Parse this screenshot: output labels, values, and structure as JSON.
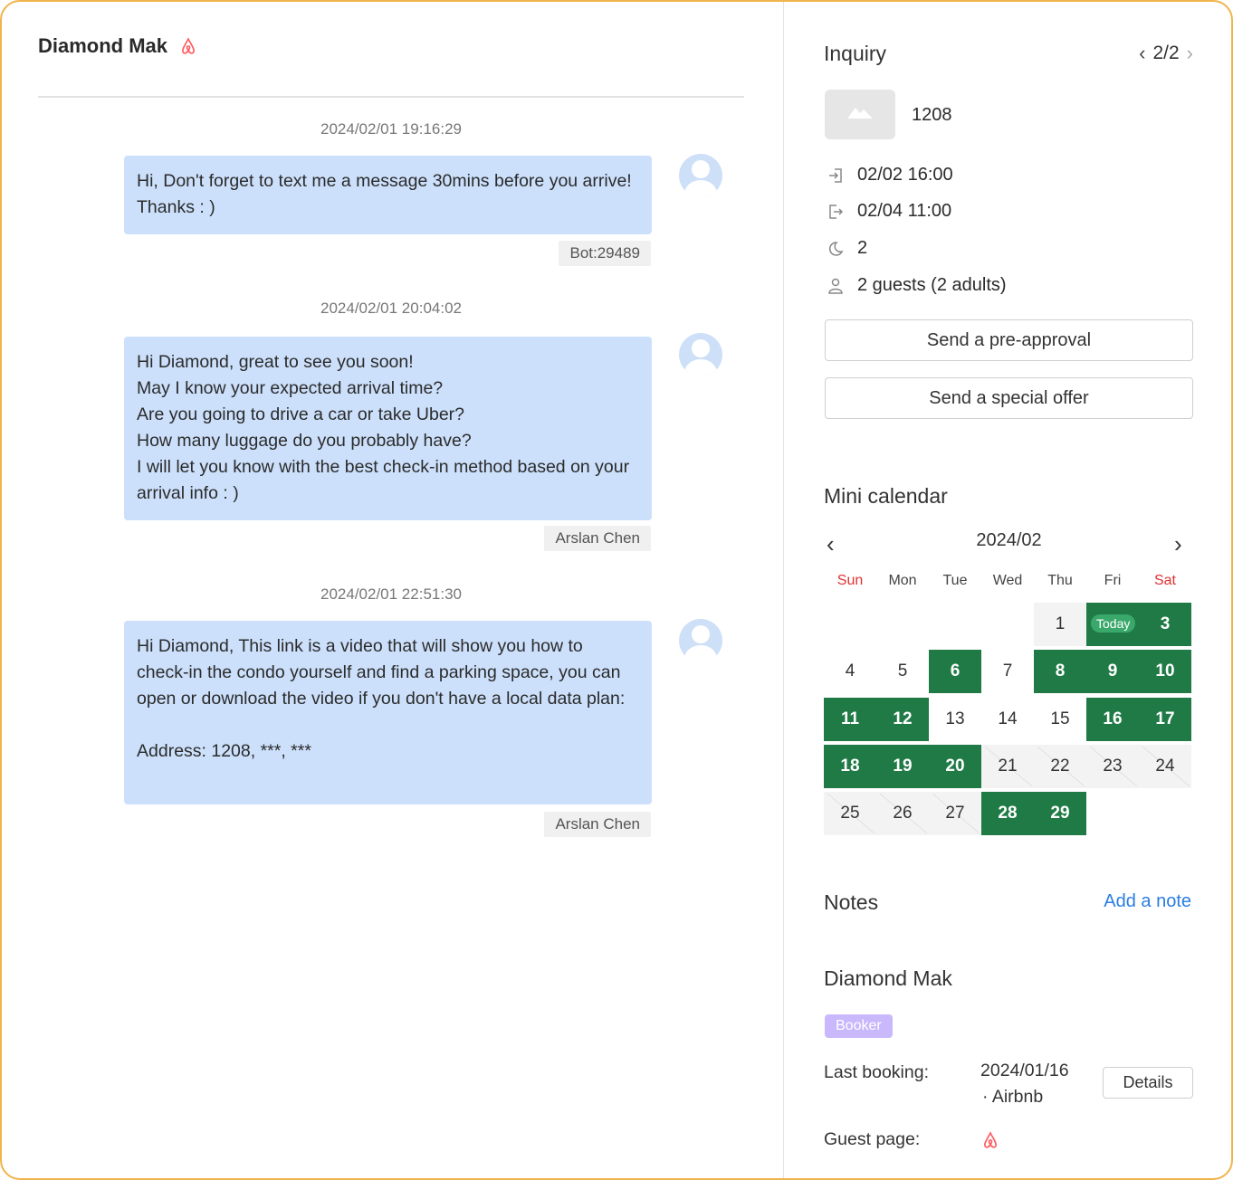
{
  "chat": {
    "guest_name": "Diamond Mak",
    "messages": [
      {
        "time": "2024/02/01 19:16:29",
        "text": "Hi, Don't forget to text me a message 30mins before you arrive! Thanks : )",
        "sender": "Bot:29489"
      },
      {
        "time": "2024/02/01 20:04:02",
        "text": "Hi Diamond, great to see you soon!\nMay I know your expected arrival time?\nAre you going to drive a car or take Uber?\nHow many luggage do you probably have?\nI will let you know with the best check-in method based on your arrival info : )",
        "sender": "Arslan Chen"
      },
      {
        "time": "2024/02/01 22:51:30",
        "text": "Hi Diamond, This link is a video that will show you how to check-in the condo yourself and find a parking space, you can open or download the video if you don't have a local data plan:\n\nAddress: 1208, ***, ***",
        "sender": "Arslan Chen"
      }
    ]
  },
  "inquiry": {
    "title": "Inquiry",
    "pager": "2/2",
    "listing": "1208",
    "checkin": "02/02  16:00",
    "checkout": "02/04  11:00",
    "nights": "2",
    "guests": "2 guests (2 adults)",
    "preapproval_label": "Send a pre-approval",
    "special_offer_label": "Send a special offer"
  },
  "calendar": {
    "title": "Mini calendar",
    "month": "2024/02",
    "weekdays": [
      "Sun",
      "Mon",
      "Tue",
      "Wed",
      "Thu",
      "Fri",
      "Sat"
    ],
    "today_label": "Today",
    "days": [
      "1",
      "2",
      "3",
      "4",
      "5",
      "6",
      "7",
      "8",
      "9",
      "10",
      "11",
      "12",
      "13",
      "14",
      "15",
      "16",
      "17",
      "18",
      "19",
      "20",
      "21",
      "22",
      "23",
      "24",
      "25",
      "26",
      "27",
      "28",
      "29"
    ],
    "booked_days": [
      2,
      3,
      6,
      8,
      9,
      10,
      11,
      12,
      16,
      17,
      18,
      19,
      20,
      28,
      29
    ],
    "past_days": [
      21,
      22,
      23,
      24,
      25,
      26,
      27
    ],
    "today": 2
  },
  "notes": {
    "title": "Notes",
    "add_label": "Add a note"
  },
  "guest": {
    "name": "Diamond Mak",
    "badge": "Booker",
    "last_booking_label": "Last booking:",
    "last_booking_date": "2024/01/16",
    "last_booking_source": "· Airbnb",
    "details_label": "Details",
    "guest_page_label": "Guest page:"
  },
  "colors": {
    "frame": "#f0b44c",
    "bubble": "#cce0fb",
    "booked": "#1f7a45",
    "today_pill": "#3aa86a",
    "badge": "#c9b8fb",
    "link": "#2a7de1",
    "weekend": "#e03131",
    "airbnb": "#ff5a5f"
  }
}
